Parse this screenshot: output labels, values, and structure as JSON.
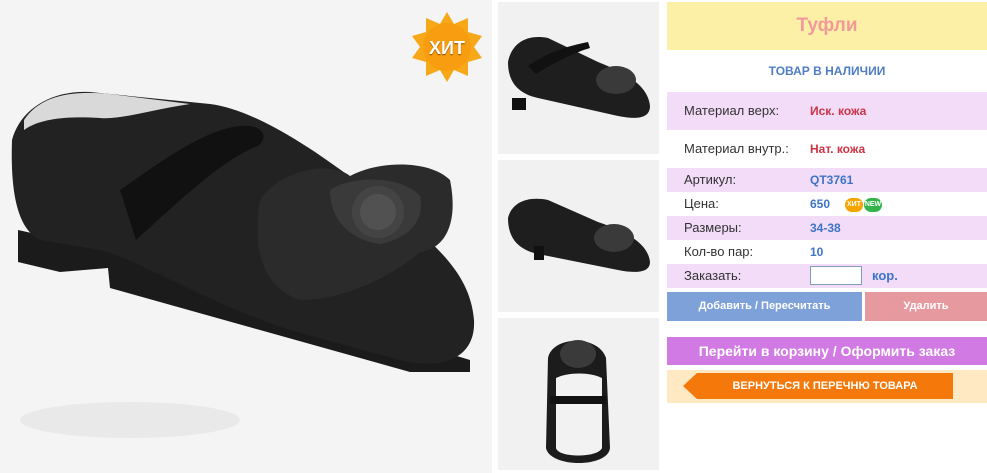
{
  "badge": {
    "text": "ХИТ"
  },
  "product": {
    "title": "Туфли",
    "availability": "ТОВАР В НАЛИЧИИ"
  },
  "specs": {
    "material_top": {
      "label": "Материал верх:",
      "value": "Иск. кожа"
    },
    "material_inner": {
      "label": "Материал внутр.:",
      "value": "Нат. кожа"
    },
    "article": {
      "label": "Артикул:",
      "value": "QT3761"
    },
    "price": {
      "label": "Цена:",
      "value": "650",
      "badges": [
        "ХИТ",
        "NEW"
      ]
    },
    "sizes": {
      "label": "Размеры:",
      "value": "34-38"
    },
    "pairs": {
      "label": "Кол-во пар:",
      "value": "10"
    },
    "order": {
      "label": "Заказать:",
      "input_value": "",
      "unit": "кор."
    }
  },
  "actions": {
    "add": "Добавить / Пересчитать",
    "delete": "Удалить",
    "cart": "Перейти в корзину / Оформить заказ",
    "back": "ВЕРНУТЬСЯ К ПЕРЕЧНЮ ТОВАРА"
  },
  "colors": {
    "title_bg": "#fbf0a6",
    "title_text": "#f29a9a",
    "row_shade": "#f2dcf8",
    "blue": "#3e74c6",
    "red": "#cc3344",
    "add_btn": "#7ea1d9",
    "delete_btn": "#e69a9f",
    "cart_btn": "#d27ae4",
    "back_btn": "#f5780a"
  },
  "icons": {
    "badge": "starburst-hit-icon",
    "back": "arrow-left-icon"
  }
}
